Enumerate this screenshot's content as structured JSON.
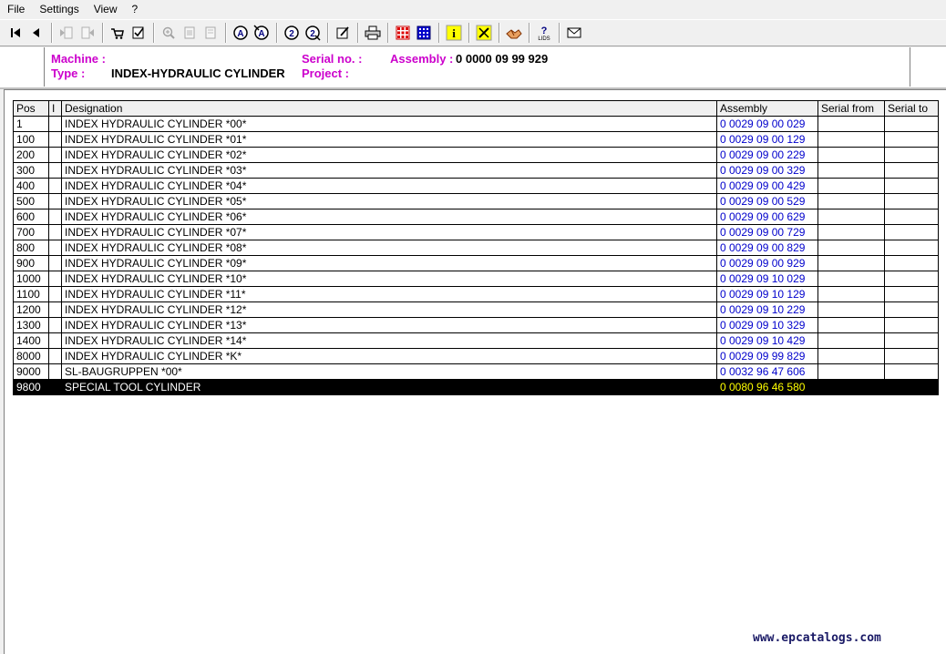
{
  "menu": [
    "File",
    "Settings",
    "View",
    "?"
  ],
  "toolbar": {
    "buttons": [
      {
        "name": "first-record-icon"
      },
      {
        "name": "previous-record-icon"
      },
      {
        "name": "sep"
      },
      {
        "name": "back-page-icon"
      },
      {
        "name": "forward-page-icon"
      },
      {
        "name": "sep"
      },
      {
        "name": "cart-icon"
      },
      {
        "name": "checklist-icon"
      },
      {
        "name": "sep"
      },
      {
        "name": "zoom-in-icon"
      },
      {
        "name": "page-icon"
      },
      {
        "name": "page-alt-icon"
      },
      {
        "name": "sep"
      },
      {
        "name": "circle-a-icon"
      },
      {
        "name": "circle-a-search-icon"
      },
      {
        "name": "sep"
      },
      {
        "name": "circle-2-icon"
      },
      {
        "name": "circle-2-search-icon"
      },
      {
        "name": "sep"
      },
      {
        "name": "edit-note-icon"
      },
      {
        "name": "sep"
      },
      {
        "name": "printer-icon"
      },
      {
        "name": "sep"
      },
      {
        "name": "red-grid-icon"
      },
      {
        "name": "blue-grid-icon"
      },
      {
        "name": "sep"
      },
      {
        "name": "info-icon"
      },
      {
        "name": "sep"
      },
      {
        "name": "tools-icon"
      },
      {
        "name": "sep"
      },
      {
        "name": "handshake-icon"
      },
      {
        "name": "sep"
      },
      {
        "name": "help-icon"
      },
      {
        "name": "sep"
      },
      {
        "name": "mail-icon"
      }
    ]
  },
  "header": {
    "machine_label": "Machine :",
    "machine_value": "",
    "type_label": "Type :",
    "type_value": "INDEX-HYDRAULIC CYLINDER",
    "serial_label": "Serial no. :",
    "serial_value": "",
    "project_label": "Project :",
    "project_value": "",
    "assembly_label": "Assembly :",
    "assembly_value": "0 0000 09 99 929"
  },
  "table": {
    "columns": [
      "Pos",
      "I",
      "Designation",
      "Assembly",
      "Serial from",
      "Serial to"
    ],
    "rows": [
      {
        "pos": "1",
        "i": "",
        "designation": "INDEX HYDRAULIC CYLINDER *00*",
        "assembly": "0 0029 09 00 029",
        "serial_from": "",
        "serial_to": ""
      },
      {
        "pos": "100",
        "i": "",
        "designation": "INDEX HYDRAULIC CYLINDER *01*",
        "assembly": "0 0029 09 00 129",
        "serial_from": "",
        "serial_to": ""
      },
      {
        "pos": "200",
        "i": "",
        "designation": "INDEX HYDRAULIC CYLINDER *02*",
        "assembly": "0 0029 09 00 229",
        "serial_from": "",
        "serial_to": ""
      },
      {
        "pos": "300",
        "i": "",
        "designation": "INDEX HYDRAULIC CYLINDER *03*",
        "assembly": "0 0029 09 00 329",
        "serial_from": "",
        "serial_to": ""
      },
      {
        "pos": "400",
        "i": "",
        "designation": "INDEX HYDRAULIC CYLINDER *04*",
        "assembly": "0 0029 09 00 429",
        "serial_from": "",
        "serial_to": ""
      },
      {
        "pos": "500",
        "i": "",
        "designation": "INDEX HYDRAULIC CYLINDER *05*",
        "assembly": "0 0029 09 00 529",
        "serial_from": "",
        "serial_to": ""
      },
      {
        "pos": "600",
        "i": "",
        "designation": "INDEX HYDRAULIC CYLINDER *06*",
        "assembly": "0 0029 09 00 629",
        "serial_from": "",
        "serial_to": ""
      },
      {
        "pos": "700",
        "i": "",
        "designation": "INDEX HYDRAULIC CYLINDER *07*",
        "assembly": "0 0029 09 00 729",
        "serial_from": "",
        "serial_to": ""
      },
      {
        "pos": "800",
        "i": "",
        "designation": "INDEX HYDRAULIC CYLINDER *08*",
        "assembly": "0 0029 09 00 829",
        "serial_from": "",
        "serial_to": ""
      },
      {
        "pos": "900",
        "i": "",
        "designation": "INDEX HYDRAULIC CYLINDER *09*",
        "assembly": "0 0029 09 00 929",
        "serial_from": "",
        "serial_to": ""
      },
      {
        "pos": "1000",
        "i": "",
        "designation": "INDEX HYDRAULIC CYLINDER *10*",
        "assembly": "0 0029 09 10 029",
        "serial_from": "",
        "serial_to": ""
      },
      {
        "pos": "1100",
        "i": "",
        "designation": "INDEX HYDRAULIC CYLINDER *11*",
        "assembly": "0 0029 09 10 129",
        "serial_from": "",
        "serial_to": ""
      },
      {
        "pos": "1200",
        "i": "",
        "designation": "INDEX HYDRAULIC CYLINDER *12*",
        "assembly": "0 0029 09 10 229",
        "serial_from": "",
        "serial_to": ""
      },
      {
        "pos": "1300",
        "i": "",
        "designation": "INDEX HYDRAULIC CYLINDER *13*",
        "assembly": "0 0029 09 10 329",
        "serial_from": "",
        "serial_to": ""
      },
      {
        "pos": "1400",
        "i": "",
        "designation": "INDEX HYDRAULIC CYLINDER *14*",
        "assembly": "0 0029 09 10 429",
        "serial_from": "",
        "serial_to": ""
      },
      {
        "pos": "8000",
        "i": "",
        "designation": "INDEX HYDRAULIC CYLINDER *K*",
        "assembly": "0 0029 09 99 829",
        "serial_from": "",
        "serial_to": ""
      },
      {
        "pos": "9000",
        "i": "",
        "designation": "SL-BAUGRUPPEN *00*",
        "assembly": "0 0032 96 47 606",
        "serial_from": "",
        "serial_to": ""
      },
      {
        "pos": "9800",
        "i": "",
        "designation": "SPECIAL TOOL CYLINDER",
        "assembly": "0 0080 96 46 580",
        "serial_from": "",
        "serial_to": "",
        "selected": true
      }
    ]
  },
  "watermark": "www.epcatalogs.com",
  "colors": {
    "label_magenta": "#cc00cc",
    "assembly_link": "#0000cc",
    "selected_bg": "#000000",
    "selected_assembly": "#ffff00"
  }
}
